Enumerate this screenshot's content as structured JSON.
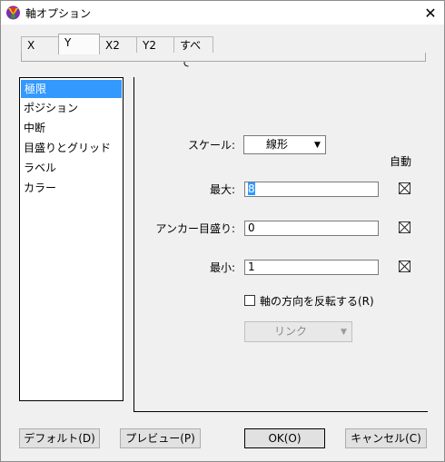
{
  "window": {
    "title": "軸オプション",
    "close_glyph": "✕"
  },
  "tabs": [
    {
      "label": "X"
    },
    {
      "label": "Y"
    },
    {
      "label": "X2"
    },
    {
      "label": "Y2"
    },
    {
      "label": "すべて"
    }
  ],
  "categories": [
    {
      "label": "極限"
    },
    {
      "label": "ポジション"
    },
    {
      "label": "中断"
    },
    {
      "label": "目盛りとグリッド"
    },
    {
      "label": "ラベル"
    },
    {
      "label": "カラー"
    }
  ],
  "form": {
    "scale_label": "スケール:",
    "scale_value": "線形",
    "auto_header": "自動",
    "max_label": "最大:",
    "max_value": "8",
    "anchor_label": "アンカー目盛り:",
    "anchor_value": "0",
    "min_label": "最小:",
    "min_value": "1",
    "invert_label": "軸の方向を反転する(R)",
    "link_value": "リンク"
  },
  "buttons": {
    "default": "デフォルト(D)",
    "preview": "プレビュー(P)",
    "ok": "OK(O)",
    "cancel": "キャンセル(C)"
  }
}
